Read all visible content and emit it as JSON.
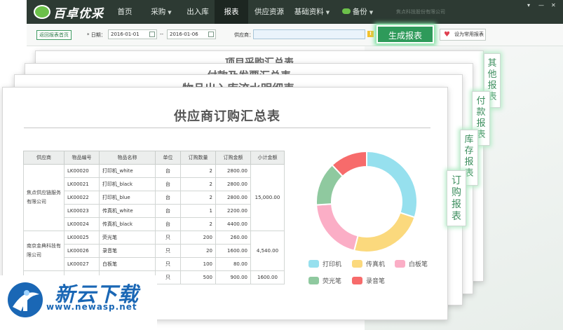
{
  "app": {
    "logo_text": "百卓优采",
    "company": "焦点科技股份有限公司"
  },
  "nav": {
    "items": [
      {
        "label": "首页"
      },
      {
        "label": "采购"
      },
      {
        "label": "出入库"
      },
      {
        "label": "报表"
      },
      {
        "label": "供应资源"
      },
      {
        "label": "基础资料"
      },
      {
        "label": "备份"
      }
    ],
    "active": "报表",
    "window_controls": [
      "▾",
      "—",
      "✕"
    ]
  },
  "toolbar": {
    "back_label": "返回报表首页",
    "date_label": "* 日期：",
    "date_from": "2016-01-01",
    "date_sep": "--",
    "date_to": "2016-01-06",
    "supplier_label": "供应商：",
    "supplier_value": "",
    "warn_icon": "!",
    "generate_label": "生成报表",
    "fav_label": "设为常用报表"
  },
  "stack": {
    "card1_title": "项目采购汇总表",
    "card2_title": "付款及发票汇总表",
    "card3_title": "物品出入库流水明细表"
  },
  "side_tabs": [
    {
      "lines": [
        "其",
        "他",
        "报",
        "表"
      ]
    },
    {
      "lines": [
        "付",
        "款",
        "报",
        "表"
      ]
    },
    {
      "lines": [
        "库",
        "存",
        "报",
        "表"
      ]
    },
    {
      "lines": [
        "订",
        "购",
        "报",
        "表"
      ]
    }
  ],
  "report": {
    "title": "供应商订购汇总表",
    "headers": [
      "供应商",
      "物品编号",
      "物品名称",
      "单位",
      "订购数量",
      "订购金额",
      "小计金额"
    ],
    "groups": [
      {
        "supplier": "焦点供应链服务有限公司",
        "subtotal": "15,000.00",
        "rows": [
          {
            "code": "LK00020",
            "name": "打印机_white",
            "unit": "台",
            "qty": "2",
            "amount": "2800.00"
          },
          {
            "code": "LK00021",
            "name": "打印机_black",
            "unit": "台",
            "qty": "2",
            "amount": "2800.00"
          },
          {
            "code": "LK00022",
            "name": "打印机_blue",
            "unit": "台",
            "qty": "2",
            "amount": "2800.00"
          },
          {
            "code": "LK00023",
            "name": "传真机_white",
            "unit": "台",
            "qty": "1",
            "amount": "2200.00"
          },
          {
            "code": "LK00024",
            "name": "传真机_black",
            "unit": "台",
            "qty": "2",
            "amount": "4400.00"
          }
        ]
      },
      {
        "supplier": "南京金典科技有限公司",
        "subtotal": "4,540.00",
        "rows": [
          {
            "code": "LK00025",
            "name": "荧光笔",
            "unit": "只",
            "qty": "200",
            "amount": "260.00"
          },
          {
            "code": "LK00026",
            "name": "录音笔",
            "unit": "只",
            "qty": "20",
            "amount": "1600.00"
          },
          {
            "code": "LK00027",
            "name": "白板笔",
            "unit": "只",
            "qty": "100",
            "amount": "80.00"
          }
        ]
      },
      {
        "supplier": "",
        "subtotal": "1600.00",
        "rows": [
          {
            "code": "",
            "name": "",
            "unit": "只",
            "qty": "500",
            "amount": "900.00"
          }
        ]
      }
    ]
  },
  "chart_data": {
    "type": "pie",
    "donut": true,
    "categories": [
      "打印机",
      "传真机",
      "白板笔",
      "荧光笔",
      "录音笔"
    ],
    "values": [
      30,
      24,
      20,
      14,
      12
    ],
    "colors": [
      "#96e0ee",
      "#fbd97d",
      "#fbaec6",
      "#8fc99f",
      "#f76b6b"
    ],
    "legend_position": "bottom"
  },
  "watermark": {
    "text": "新云下载",
    "url": "www.newasp.net"
  }
}
